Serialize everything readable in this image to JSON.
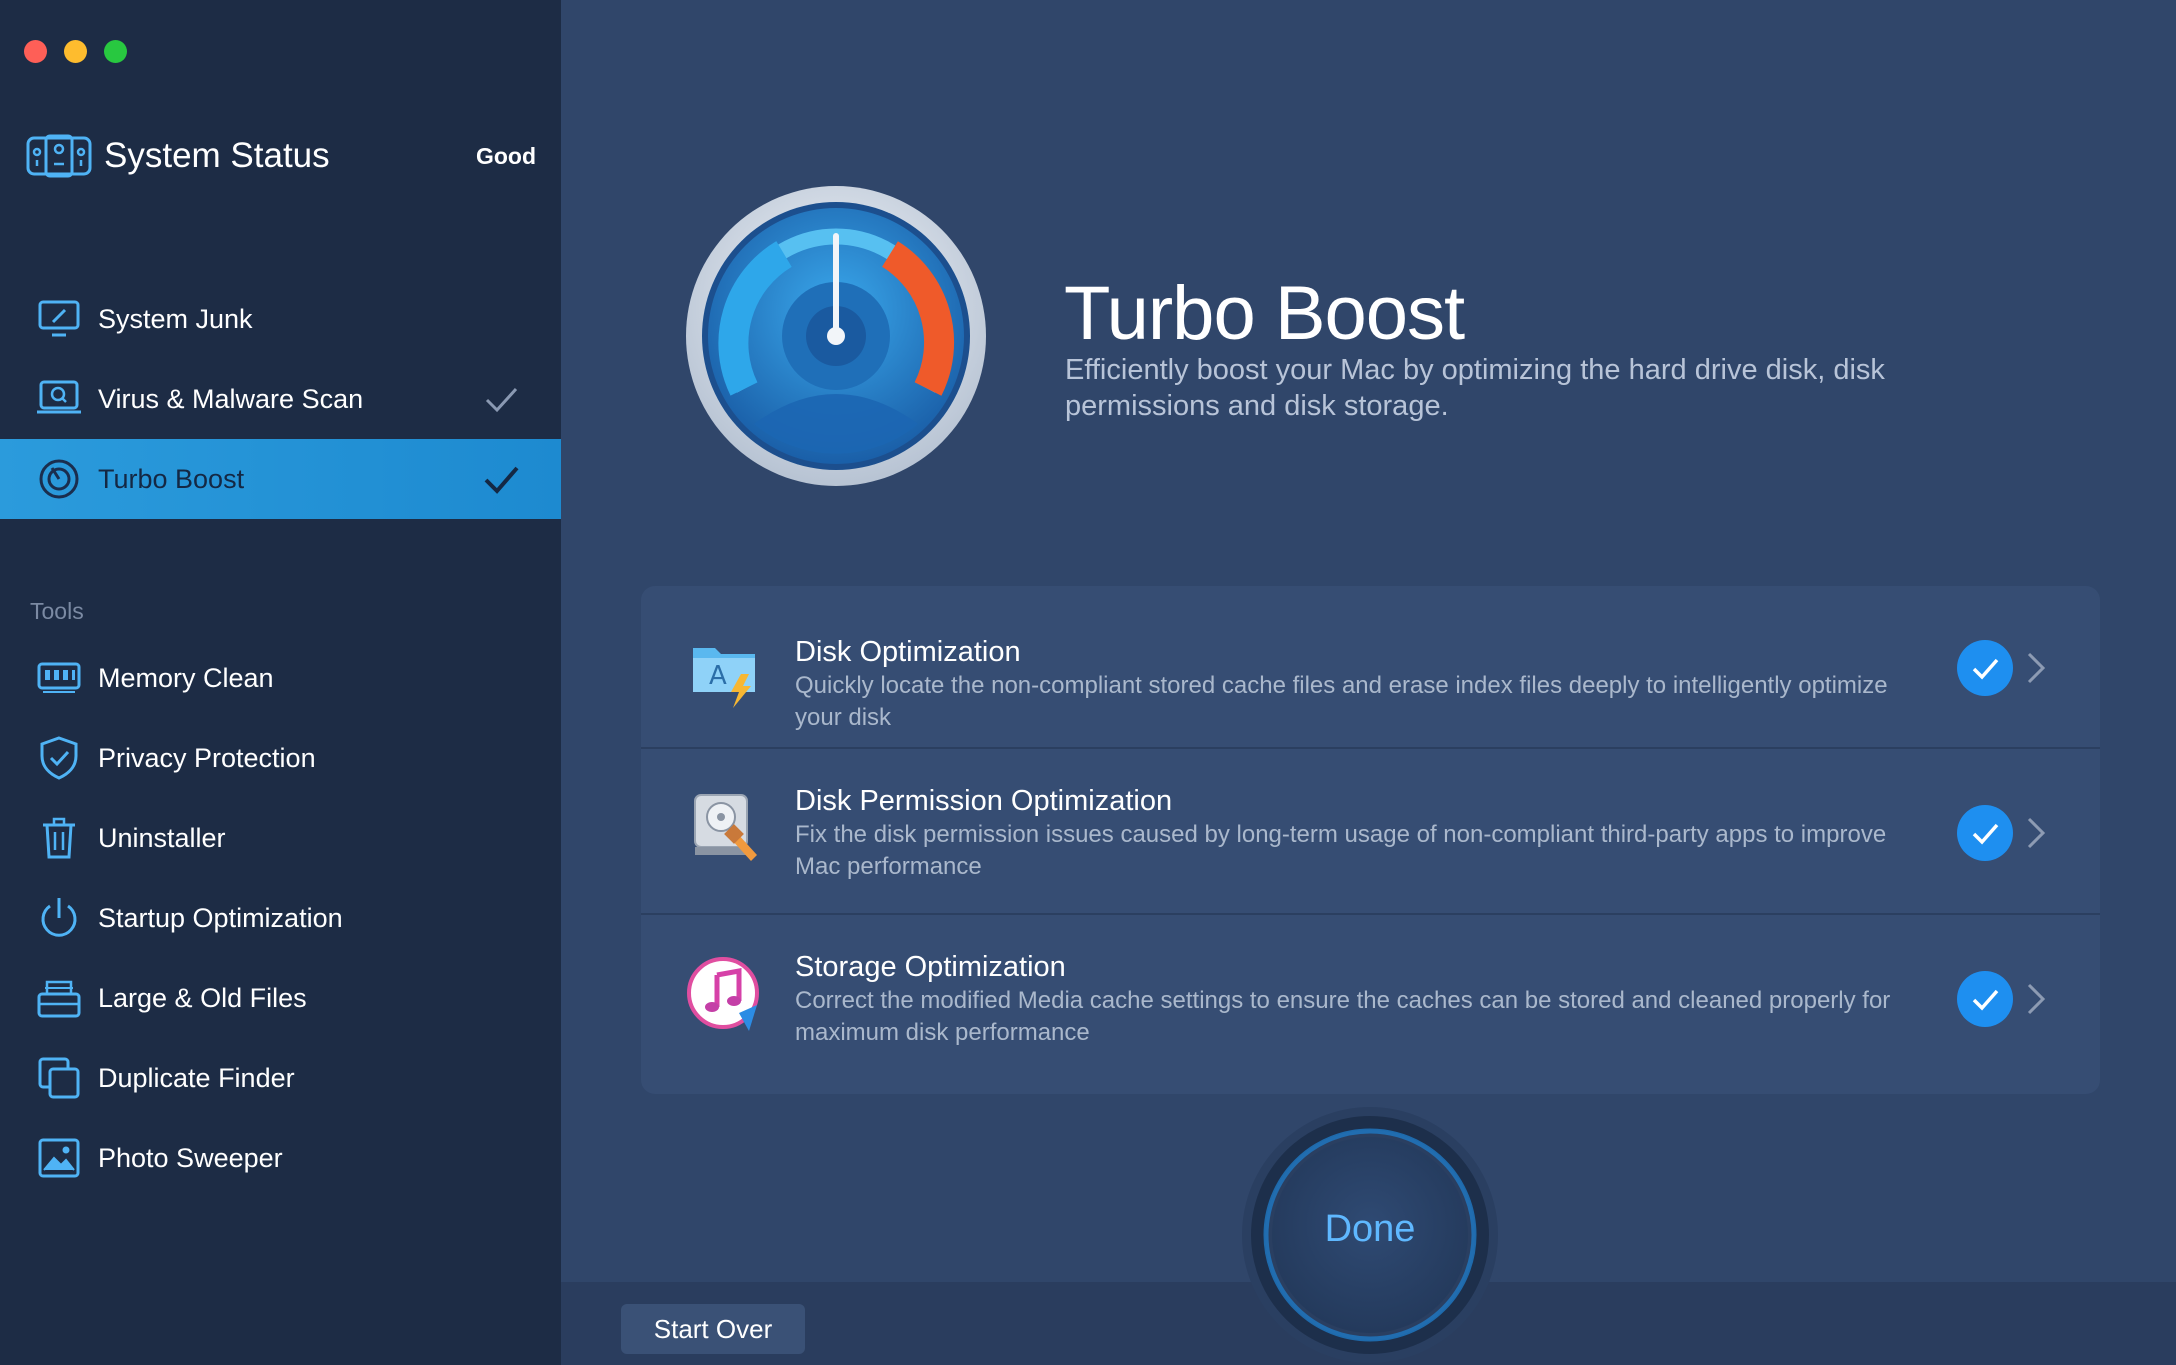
{
  "window": {
    "controls": [
      "close",
      "minimize",
      "zoom"
    ]
  },
  "sidebar": {
    "status": {
      "title": "System Status",
      "value": "Good",
      "icon": "system-status-icon"
    },
    "items": [
      {
        "label": "System Junk",
        "icon": "monitor-broom-icon",
        "checked": false,
        "active": false
      },
      {
        "label": "Virus & Malware Scan",
        "icon": "monitor-search-icon",
        "checked": true,
        "active": false
      },
      {
        "label": "Turbo Boost",
        "icon": "speedometer-icon",
        "checked": true,
        "active": true
      }
    ],
    "tools_label": "Tools",
    "tools": [
      {
        "label": "Memory Clean",
        "icon": "memory-chip-icon"
      },
      {
        "label": "Privacy Protection",
        "icon": "shield-check-icon"
      },
      {
        "label": "Uninstaller",
        "icon": "trash-icon"
      },
      {
        "label": "Startup Optimization",
        "icon": "power-icon"
      },
      {
        "label": "Large & Old Files",
        "icon": "file-box-icon"
      },
      {
        "label": "Duplicate Finder",
        "icon": "duplicate-files-icon"
      },
      {
        "label": "Photo Sweeper",
        "icon": "photo-icon"
      }
    ]
  },
  "hero": {
    "title": "Turbo Boost",
    "description": "Efficiently boost your Mac by optimizing the hard drive disk, disk permissions and disk storage."
  },
  "optimizations": [
    {
      "title": "Disk Optimization",
      "description": "Quickly locate the non-compliant stored cache files and erase index files deeply to intelligently optimize your disk",
      "checked": true
    },
    {
      "title": "Disk Permission Optimization",
      "description": "Fix the disk permission issues caused by long-term usage of non-compliant third-party apps to improve Mac performance",
      "checked": true
    },
    {
      "title": "Storage Optimization",
      "description": "Correct the modified Media cache settings to ensure the caches can be stored and cleaned properly for maximum disk performance",
      "checked": true
    }
  ],
  "actions": {
    "done": "Done",
    "start_over": "Start Over"
  },
  "colors": {
    "accent": "#1e8ff0",
    "sidebar_bg": "#1d2c45",
    "main_bg": "#30466a",
    "active_item": "#2196d8"
  }
}
